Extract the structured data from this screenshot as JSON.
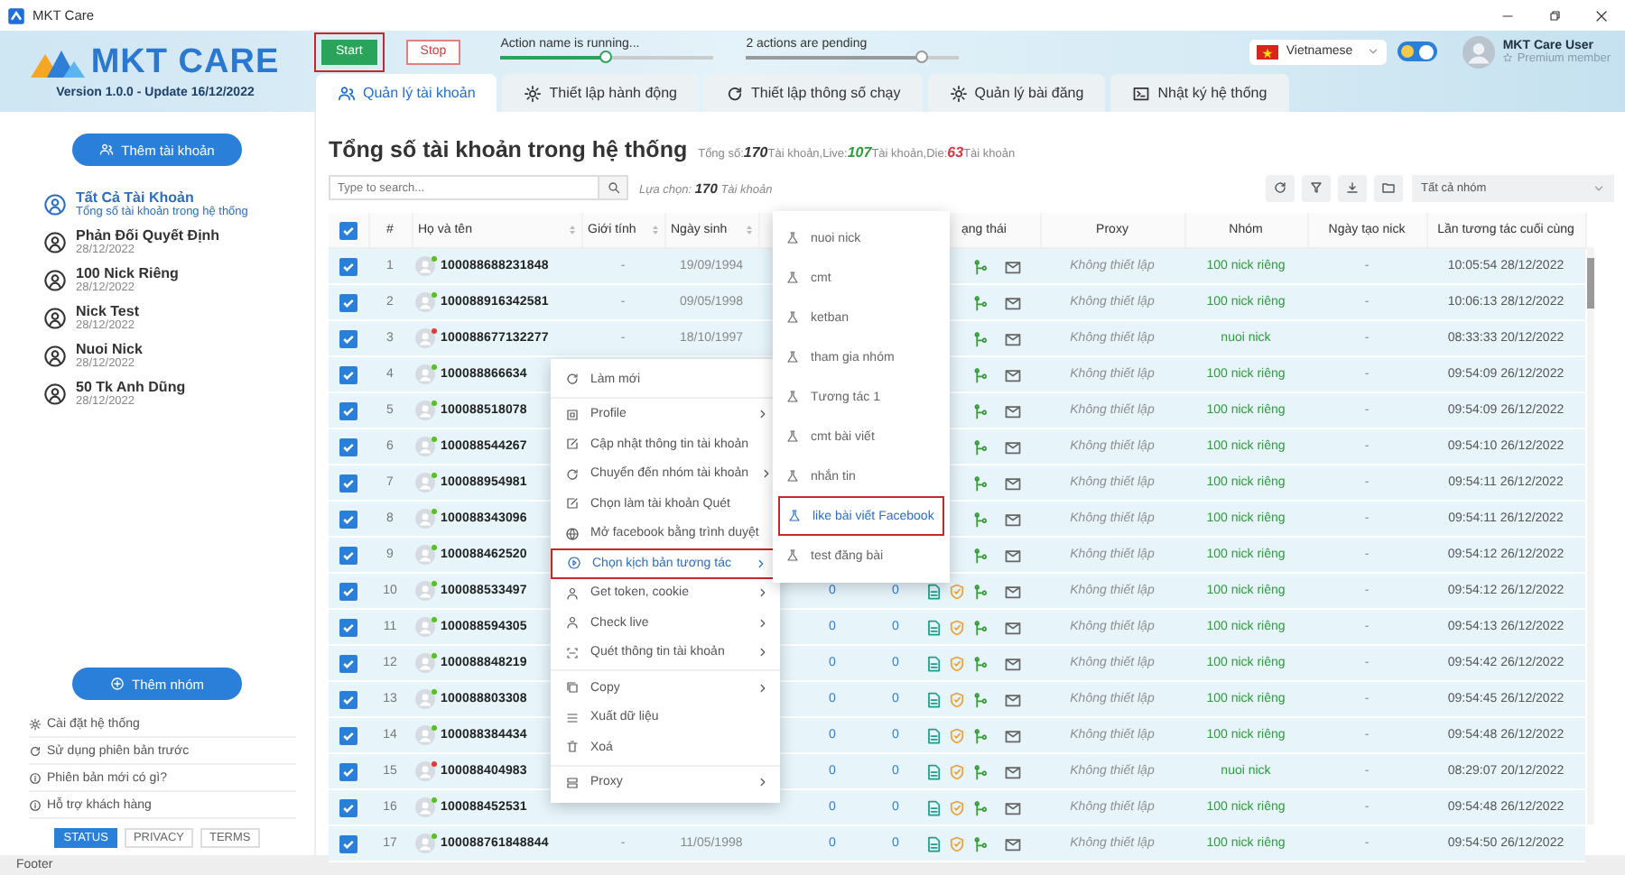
{
  "window": {
    "title": "MKT Care"
  },
  "brand": {
    "name": "MKT CARE",
    "version": "Version 1.0.0 - Update 16/12/2022"
  },
  "controls": [
    {
      "kind": "start",
      "label": "Start",
      "highlighted": true
    },
    {
      "kind": "stop",
      "label": "Stop",
      "highlighted": false
    }
  ],
  "progress": [
    {
      "label": "Action name is running...",
      "running": true,
      "level": 0.5
    },
    {
      "label": "2 actions are pending",
      "running": false,
      "level": 0.83
    }
  ],
  "language": {
    "value": "Vietnamese"
  },
  "theme_toggle": {
    "on": true
  },
  "user": {
    "name": "MKT Care User",
    "badge": "Premium member"
  },
  "tabs": [
    {
      "label": "Quản lý tài khoản",
      "selected": true
    },
    {
      "label": "Thiết lập hành động",
      "selected": false
    },
    {
      "label": "Thiết lập thông số chạy",
      "selected": false
    },
    {
      "label": "Quản lý bài đăng",
      "selected": false
    },
    {
      "label": "Nhật ký hệ thống",
      "selected": false
    }
  ],
  "sidebar": {
    "add_button": "Thêm tài khoản",
    "groups": [
      {
        "name": "Tất Cả Tài Khoản",
        "detail": "Tổng số tài khoản trong hệ thống",
        "selected": true
      },
      {
        "name": "Phản Đối Quyết Định",
        "detail": "28/12/2022",
        "selected": false
      },
      {
        "name": "100 Nick Riêng",
        "detail": "28/12/2022",
        "selected": false
      },
      {
        "name": "Nick Test",
        "detail": "28/12/2022",
        "selected": false
      },
      {
        "name": "Nuoi Nick",
        "detail": "28/12/2022",
        "selected": false
      },
      {
        "name": "50 Tk Anh Dũng",
        "detail": "28/12/2022",
        "selected": false
      }
    ],
    "add_group_button": "Thêm nhóm",
    "links": [
      "Cài đặt hệ thống",
      "Sử dụng phiên bản trước",
      "Phiên bản mới có gì?",
      "Hỗ trợ khách hàng"
    ],
    "footer_tabs": [
      {
        "label": "STATUS",
        "selected": true
      },
      {
        "label": "PRIVACY",
        "selected": false
      },
      {
        "label": "TERMS",
        "selected": false
      }
    ]
  },
  "main": {
    "title": "Tổng số tài khoản trong hệ thống",
    "stats": [
      {
        "label": "Tổng số:",
        "value": "170",
        "unit": "Tài khoản,",
        "color": "#333333"
      },
      {
        "label": "Live:",
        "value": "107",
        "unit": "Tài khoản,",
        "color": "#2e9d3c"
      },
      {
        "label": "Die:",
        "value": "63",
        "unit": "Tài khoản",
        "color": "#d9363e"
      }
    ],
    "search": {
      "placeholder": "Type to search..."
    },
    "selection": {
      "label": "Lựa chọn:",
      "value": "170",
      "unit": "Tài khoản"
    },
    "group_filter": {
      "value": "Tất cả nhóm"
    }
  },
  "table": {
    "all_checked": true,
    "columns": [
      {
        "label": "#",
        "sortable": false
      },
      {
        "label": "Họ và tên",
        "sortable": true
      },
      {
        "label": "Giới tính",
        "sortable": true
      },
      {
        "label": "Ngày sinh",
        "sortable": true
      },
      {
        "label": "ạng thái",
        "sortable": false
      },
      {
        "label": "Proxy",
        "sortable": false
      },
      {
        "label": "Nhóm",
        "sortable": false
      },
      {
        "label": "Ngày tạo nick",
        "sortable": false
      },
      {
        "label": "Lần tương tác cuối cùng",
        "sortable": false
      }
    ],
    "rows": [
      {
        "checked": true,
        "num": "1",
        "name": "100088688231848",
        "color": "#52c41a",
        "gender": "-",
        "birth": "19/09/1994",
        "proxy": "Không thiết lập",
        "group": "100 nick riêng",
        "created": "-",
        "last": "10:05:54 28/12/2022"
      },
      {
        "checked": true,
        "num": "2",
        "name": "100088916342581",
        "color": "#52c41a",
        "gender": "-",
        "birth": "09/05/1998",
        "proxy": "Không thiết lập",
        "group": "100 nick riêng",
        "created": "-",
        "last": "10:06:13 28/12/2022"
      },
      {
        "checked": true,
        "num": "3",
        "name": "100088677132277",
        "color": "#e53935",
        "gender": "-",
        "birth": "18/10/1997",
        "proxy": "Không thiết lập",
        "group": "nuoi nick",
        "created": "-",
        "last": "08:33:33 20/12/2022"
      },
      {
        "checked": true,
        "num": "4",
        "name": "100088866634",
        "color": "#52c41a",
        "proxy": "Không thiết lập",
        "group": "100 nick riêng",
        "created": "-",
        "last": "09:54:09 26/12/2022"
      },
      {
        "checked": true,
        "num": "5",
        "name": "100088518078",
        "color": "#52c41a",
        "proxy": "Không thiết lập",
        "group": "100 nick riêng",
        "created": "-",
        "last": "09:54:09 26/12/2022"
      },
      {
        "checked": true,
        "num": "6",
        "name": "100088544267",
        "color": "#52c41a",
        "proxy": "Không thiết lập",
        "group": "100 nick riêng",
        "created": "-",
        "last": "09:54:10 26/12/2022"
      },
      {
        "checked": true,
        "num": "7",
        "name": "100088954981",
        "color": "#52c41a",
        "proxy": "Không thiết lập",
        "group": "100 nick riêng",
        "created": "-",
        "last": "09:54:11 26/12/2022"
      },
      {
        "checked": true,
        "num": "8",
        "name": "100088343096",
        "color": "#52c41a",
        "proxy": "Không thiết lập",
        "group": "100 nick riêng",
        "created": "-",
        "last": "09:54:11 26/12/2022"
      },
      {
        "checked": true,
        "num": "9",
        "name": "100088462520",
        "color": "#52c41a",
        "proxy": "Không thiết lập",
        "group": "100 nick riêng",
        "created": "-",
        "last": "09:54:12 26/12/2022"
      },
      {
        "checked": true,
        "num": "10",
        "name": "100088533497",
        "color": "#52c41a",
        "column_7": "0",
        "column_8": "0",
        "proxy": "Không thiết lập",
        "group": "100 nick riêng",
        "created": "-",
        "last": "09:54:12 26/12/2022"
      },
      {
        "checked": true,
        "num": "11",
        "name": "100088594305",
        "color": "#52c41a",
        "column_7": "0",
        "column_8": "0",
        "proxy": "Không thiết lập",
        "group": "100 nick riêng",
        "created": "-",
        "last": "09:54:13 26/12/2022"
      },
      {
        "checked": true,
        "num": "12",
        "name": "100088848219",
        "color": "#52c41a",
        "column_7": "0",
        "column_8": "0",
        "proxy": "Không thiết lập",
        "group": "100 nick riêng",
        "created": "-",
        "last": "09:54:42 26/12/2022"
      },
      {
        "checked": true,
        "num": "13",
        "name": "100088803308",
        "color": "#52c41a",
        "column_7": "0",
        "column_8": "0",
        "proxy": "Không thiết lập",
        "group": "100 nick riêng",
        "created": "-",
        "last": "09:54:45 26/12/2022"
      },
      {
        "checked": true,
        "num": "14",
        "name": "100088384434",
        "color": "#52c41a",
        "column_7": "0",
        "column_8": "0",
        "proxy": "Không thiết lập",
        "group": "100 nick riêng",
        "created": "-",
        "last": "09:54:48 26/12/2022"
      },
      {
        "checked": true,
        "num": "15",
        "name": "100088404983",
        "color": "#e53935",
        "column_7": "0",
        "column_8": "0",
        "proxy": "Không thiết lập",
        "group": "nuoi nick",
        "created": "-",
        "last": "08:29:07 20/12/2022"
      },
      {
        "checked": true,
        "num": "16",
        "name": "100088452531",
        "color": "#52c41a",
        "column_7": "0",
        "column_8": "0",
        "proxy": "Không thiết lập",
        "group": "100 nick riêng",
        "created": "-",
        "last": "09:54:48 26/12/2022"
      },
      {
        "checked": true,
        "num": "17",
        "name": "100088761848844",
        "color": "#52c41a",
        "gender": "-",
        "birth": "11/05/1998",
        "column_7": "0",
        "column_8": "0",
        "proxy": "Không thiết lập",
        "group": "100 nick riêng",
        "created": "-",
        "last": "09:54:50 26/12/2022"
      }
    ]
  },
  "context_menu": {
    "items": [
      {
        "label": "Làm mới",
        "submenu": false,
        "divider": false,
        "selected": false
      },
      {
        "label": "Profile",
        "submenu": true,
        "divider": true,
        "selected": false
      },
      {
        "label": "Cập nhật thông tin tài khoản",
        "submenu": false,
        "divider": false,
        "selected": false
      },
      {
        "label": "Chuyển đến nhóm tài khoản",
        "submenu": true,
        "divider": false,
        "selected": false
      },
      {
        "label": "Chọn làm tài khoản Quét",
        "submenu": false,
        "divider": false,
        "selected": false
      },
      {
        "label": "Mở facebook bằng trình duyệt",
        "submenu": false,
        "divider": false,
        "selected": false
      },
      {
        "label": "Chọn kịch bản tương tác",
        "submenu": true,
        "divider": false,
        "selected": true
      },
      {
        "label": "Get token, cookie",
        "submenu": true,
        "divider": false,
        "selected": false
      },
      {
        "label": "Check live",
        "submenu": true,
        "divider": false,
        "selected": false
      },
      {
        "label": "Quét thông tin tài khoản",
        "submenu": true,
        "divider": false,
        "selected": false
      },
      {
        "label": "Copy",
        "submenu": true,
        "divider": true,
        "selected": false
      },
      {
        "label": "Xuất dữ liệu",
        "submenu": false,
        "divider": false,
        "selected": false
      },
      {
        "label": "Xoá",
        "submenu": false,
        "divider": false,
        "selected": false
      },
      {
        "label": "Proxy",
        "submenu": true,
        "divider": true,
        "selected": false
      }
    ]
  },
  "submenu": {
    "items": [
      {
        "label": "nuoi nick",
        "selected": false
      },
      {
        "label": "cmt",
        "selected": false
      },
      {
        "label": "ketban",
        "selected": false
      },
      {
        "label": "tham gia nhóm",
        "selected": false
      },
      {
        "label": "Tương tác 1",
        "selected": false
      },
      {
        "label": "cmt bài viết",
        "selected": false
      },
      {
        "label": "nhắn tin",
        "selected": false
      },
      {
        "label": "like bài viết Facebook",
        "selected": true
      },
      {
        "label": "test đăng bài",
        "selected": false
      }
    ]
  },
  "status_bar": {
    "text": "Footer"
  }
}
